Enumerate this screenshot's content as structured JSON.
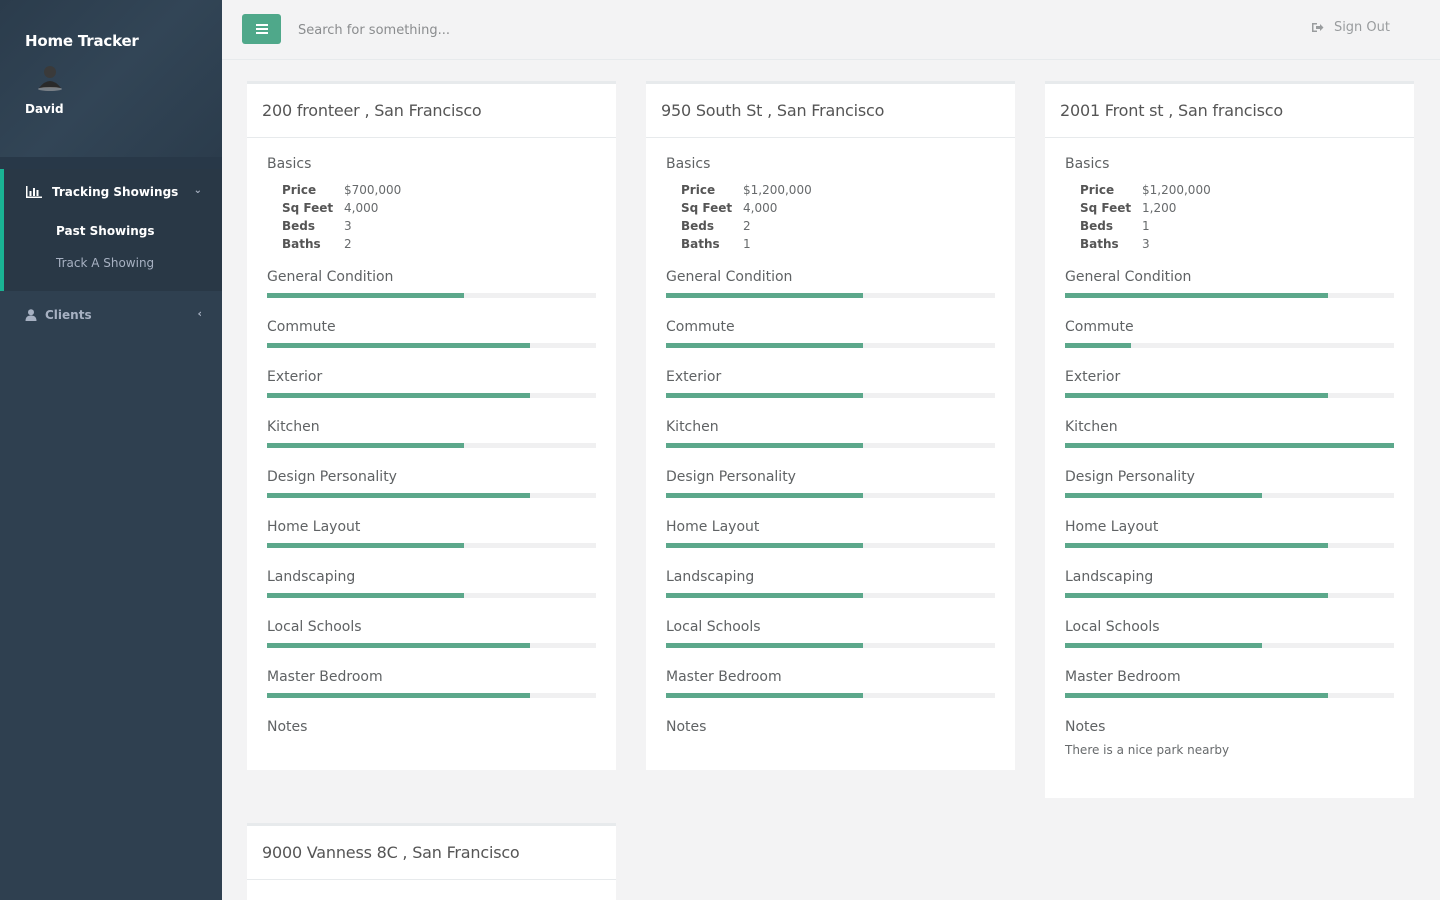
{
  "app": {
    "title": "Home Tracker"
  },
  "user": {
    "name": "David"
  },
  "sidebar": {
    "group_label": "Tracking Showings",
    "sub_items": [
      {
        "label": "Past Showings",
        "active": true
      },
      {
        "label": "Track A Showing",
        "active": false
      }
    ],
    "clients_label": "Clients"
  },
  "topbar": {
    "search_placeholder": "Search for something...",
    "signout_label": "Sign Out"
  },
  "colors": {
    "accent": "#5ca88b",
    "sidebar": "#2f4050"
  },
  "labels": {
    "basics": "Basics",
    "price": "Price",
    "sqft": "Sq Feet",
    "beds": "Beds",
    "baths": "Baths",
    "notes": "Notes",
    "metrics": [
      "General Condition",
      "Commute",
      "Exterior",
      "Kitchen",
      "Design Personality",
      "Home Layout",
      "Landscaping",
      "Local Schools",
      "Master Bedroom"
    ]
  },
  "properties": [
    {
      "title": "200 fronteer , San Francisco",
      "price": "$700,000",
      "sqft": "4,000",
      "beds": "3",
      "baths": "2",
      "ratings_pct": [
        60,
        80,
        80,
        60,
        80,
        60,
        60,
        80,
        80
      ],
      "notes": ""
    },
    {
      "title": "950 South St , San Francisco",
      "price": "$1,200,000",
      "sqft": "4,000",
      "beds": "2",
      "baths": "1",
      "ratings_pct": [
        60,
        60,
        60,
        60,
        60,
        60,
        60,
        60,
        60
      ],
      "notes": ""
    },
    {
      "title": "2001 Front st , San francisco",
      "price": "$1,200,000",
      "sqft": "1,200",
      "beds": "1",
      "baths": "3",
      "ratings_pct": [
        80,
        20,
        80,
        100,
        60,
        80,
        80,
        60,
        80
      ],
      "notes": "There is a nice park nearby"
    },
    {
      "title": "9000 Vanness 8C , San Francisco"
    }
  ]
}
